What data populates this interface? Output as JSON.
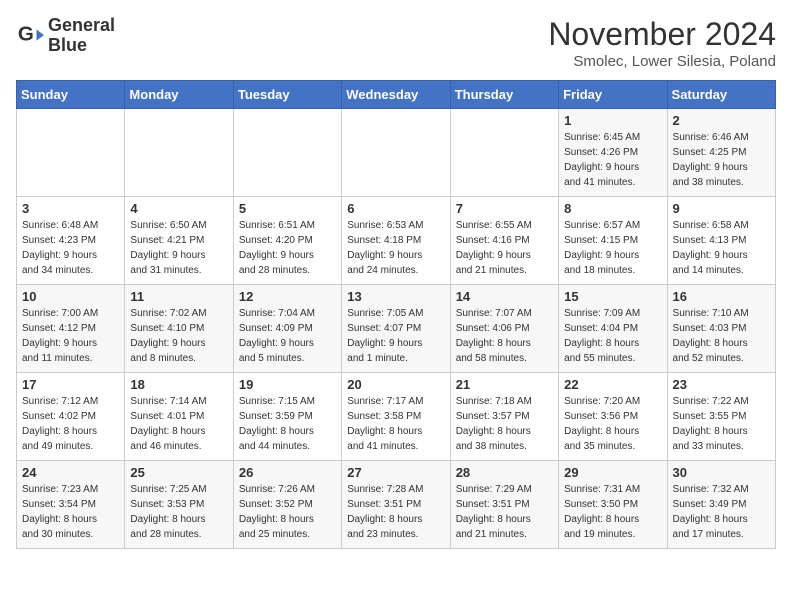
{
  "logo": {
    "line1": "General",
    "line2": "Blue"
  },
  "title": "November 2024",
  "location": "Smolec, Lower Silesia, Poland",
  "weekdays": [
    "Sunday",
    "Monday",
    "Tuesday",
    "Wednesday",
    "Thursday",
    "Friday",
    "Saturday"
  ],
  "weeks": [
    [
      {
        "day": "",
        "info": ""
      },
      {
        "day": "",
        "info": ""
      },
      {
        "day": "",
        "info": ""
      },
      {
        "day": "",
        "info": ""
      },
      {
        "day": "",
        "info": ""
      },
      {
        "day": "1",
        "info": "Sunrise: 6:45 AM\nSunset: 4:26 PM\nDaylight: 9 hours\nand 41 minutes."
      },
      {
        "day": "2",
        "info": "Sunrise: 6:46 AM\nSunset: 4:25 PM\nDaylight: 9 hours\nand 38 minutes."
      }
    ],
    [
      {
        "day": "3",
        "info": "Sunrise: 6:48 AM\nSunset: 4:23 PM\nDaylight: 9 hours\nand 34 minutes."
      },
      {
        "day": "4",
        "info": "Sunrise: 6:50 AM\nSunset: 4:21 PM\nDaylight: 9 hours\nand 31 minutes."
      },
      {
        "day": "5",
        "info": "Sunrise: 6:51 AM\nSunset: 4:20 PM\nDaylight: 9 hours\nand 28 minutes."
      },
      {
        "day": "6",
        "info": "Sunrise: 6:53 AM\nSunset: 4:18 PM\nDaylight: 9 hours\nand 24 minutes."
      },
      {
        "day": "7",
        "info": "Sunrise: 6:55 AM\nSunset: 4:16 PM\nDaylight: 9 hours\nand 21 minutes."
      },
      {
        "day": "8",
        "info": "Sunrise: 6:57 AM\nSunset: 4:15 PM\nDaylight: 9 hours\nand 18 minutes."
      },
      {
        "day": "9",
        "info": "Sunrise: 6:58 AM\nSunset: 4:13 PM\nDaylight: 9 hours\nand 14 minutes."
      }
    ],
    [
      {
        "day": "10",
        "info": "Sunrise: 7:00 AM\nSunset: 4:12 PM\nDaylight: 9 hours\nand 11 minutes."
      },
      {
        "day": "11",
        "info": "Sunrise: 7:02 AM\nSunset: 4:10 PM\nDaylight: 9 hours\nand 8 minutes."
      },
      {
        "day": "12",
        "info": "Sunrise: 7:04 AM\nSunset: 4:09 PM\nDaylight: 9 hours\nand 5 minutes."
      },
      {
        "day": "13",
        "info": "Sunrise: 7:05 AM\nSunset: 4:07 PM\nDaylight: 9 hours\nand 1 minute."
      },
      {
        "day": "14",
        "info": "Sunrise: 7:07 AM\nSunset: 4:06 PM\nDaylight: 8 hours\nand 58 minutes."
      },
      {
        "day": "15",
        "info": "Sunrise: 7:09 AM\nSunset: 4:04 PM\nDaylight: 8 hours\nand 55 minutes."
      },
      {
        "day": "16",
        "info": "Sunrise: 7:10 AM\nSunset: 4:03 PM\nDaylight: 8 hours\nand 52 minutes."
      }
    ],
    [
      {
        "day": "17",
        "info": "Sunrise: 7:12 AM\nSunset: 4:02 PM\nDaylight: 8 hours\nand 49 minutes."
      },
      {
        "day": "18",
        "info": "Sunrise: 7:14 AM\nSunset: 4:01 PM\nDaylight: 8 hours\nand 46 minutes."
      },
      {
        "day": "19",
        "info": "Sunrise: 7:15 AM\nSunset: 3:59 PM\nDaylight: 8 hours\nand 44 minutes."
      },
      {
        "day": "20",
        "info": "Sunrise: 7:17 AM\nSunset: 3:58 PM\nDaylight: 8 hours\nand 41 minutes."
      },
      {
        "day": "21",
        "info": "Sunrise: 7:18 AM\nSunset: 3:57 PM\nDaylight: 8 hours\nand 38 minutes."
      },
      {
        "day": "22",
        "info": "Sunrise: 7:20 AM\nSunset: 3:56 PM\nDaylight: 8 hours\nand 35 minutes."
      },
      {
        "day": "23",
        "info": "Sunrise: 7:22 AM\nSunset: 3:55 PM\nDaylight: 8 hours\nand 33 minutes."
      }
    ],
    [
      {
        "day": "24",
        "info": "Sunrise: 7:23 AM\nSunset: 3:54 PM\nDaylight: 8 hours\nand 30 minutes."
      },
      {
        "day": "25",
        "info": "Sunrise: 7:25 AM\nSunset: 3:53 PM\nDaylight: 8 hours\nand 28 minutes."
      },
      {
        "day": "26",
        "info": "Sunrise: 7:26 AM\nSunset: 3:52 PM\nDaylight: 8 hours\nand 25 minutes."
      },
      {
        "day": "27",
        "info": "Sunrise: 7:28 AM\nSunset: 3:51 PM\nDaylight: 8 hours\nand 23 minutes."
      },
      {
        "day": "28",
        "info": "Sunrise: 7:29 AM\nSunset: 3:51 PM\nDaylight: 8 hours\nand 21 minutes."
      },
      {
        "day": "29",
        "info": "Sunrise: 7:31 AM\nSunset: 3:50 PM\nDaylight: 8 hours\nand 19 minutes."
      },
      {
        "day": "30",
        "info": "Sunrise: 7:32 AM\nSunset: 3:49 PM\nDaylight: 8 hours\nand 17 minutes."
      }
    ]
  ]
}
